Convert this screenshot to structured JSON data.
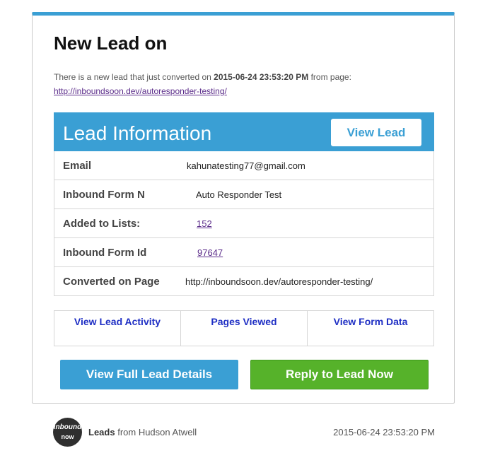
{
  "email": {
    "title": "New Lead on",
    "intro_prefix": "There is a new lead that just converted on",
    "converted_datetime": "2015-06-24 23:53:20 PM",
    "intro_suffix": "from page:",
    "page_url": "http://inboundsoon.dev/autoresponder-testing/"
  },
  "lead_info": {
    "heading": "Lead Information",
    "view_lead_label": "View Lead",
    "rows": [
      {
        "label": "Email",
        "value": "kahunatesting77@gmail.com",
        "is_link": false
      },
      {
        "label": "Inbound Form N",
        "value": "Auto Responder Test",
        "is_link": false
      },
      {
        "label": "Added to Lists:",
        "value": "152",
        "is_link": true
      },
      {
        "label": "Inbound Form Id",
        "value": "97647",
        "is_link": true
      },
      {
        "label": "Converted on Page",
        "value": "http://inboundsoon.dev/autoresponder-testing/",
        "is_link": false
      }
    ]
  },
  "quick_links": [
    "View Lead Activity",
    "Pages Viewed",
    "View Form Data"
  ],
  "actions": {
    "full_details_label": "View Full Lead Details",
    "reply_label": "Reply to Lead Now"
  },
  "footer": {
    "logo_top": "inbound",
    "logo_bottom": "now",
    "app_name": "Leads",
    "from_text": "from Hudson Atwell",
    "date": "2015-06-24 23:53:20 PM"
  },
  "colors": {
    "accent_blue": "#3a9fd4",
    "reply_green": "#56b22a",
    "link_purple": "#5b2c8a",
    "link_blue": "#1f2fc4"
  }
}
